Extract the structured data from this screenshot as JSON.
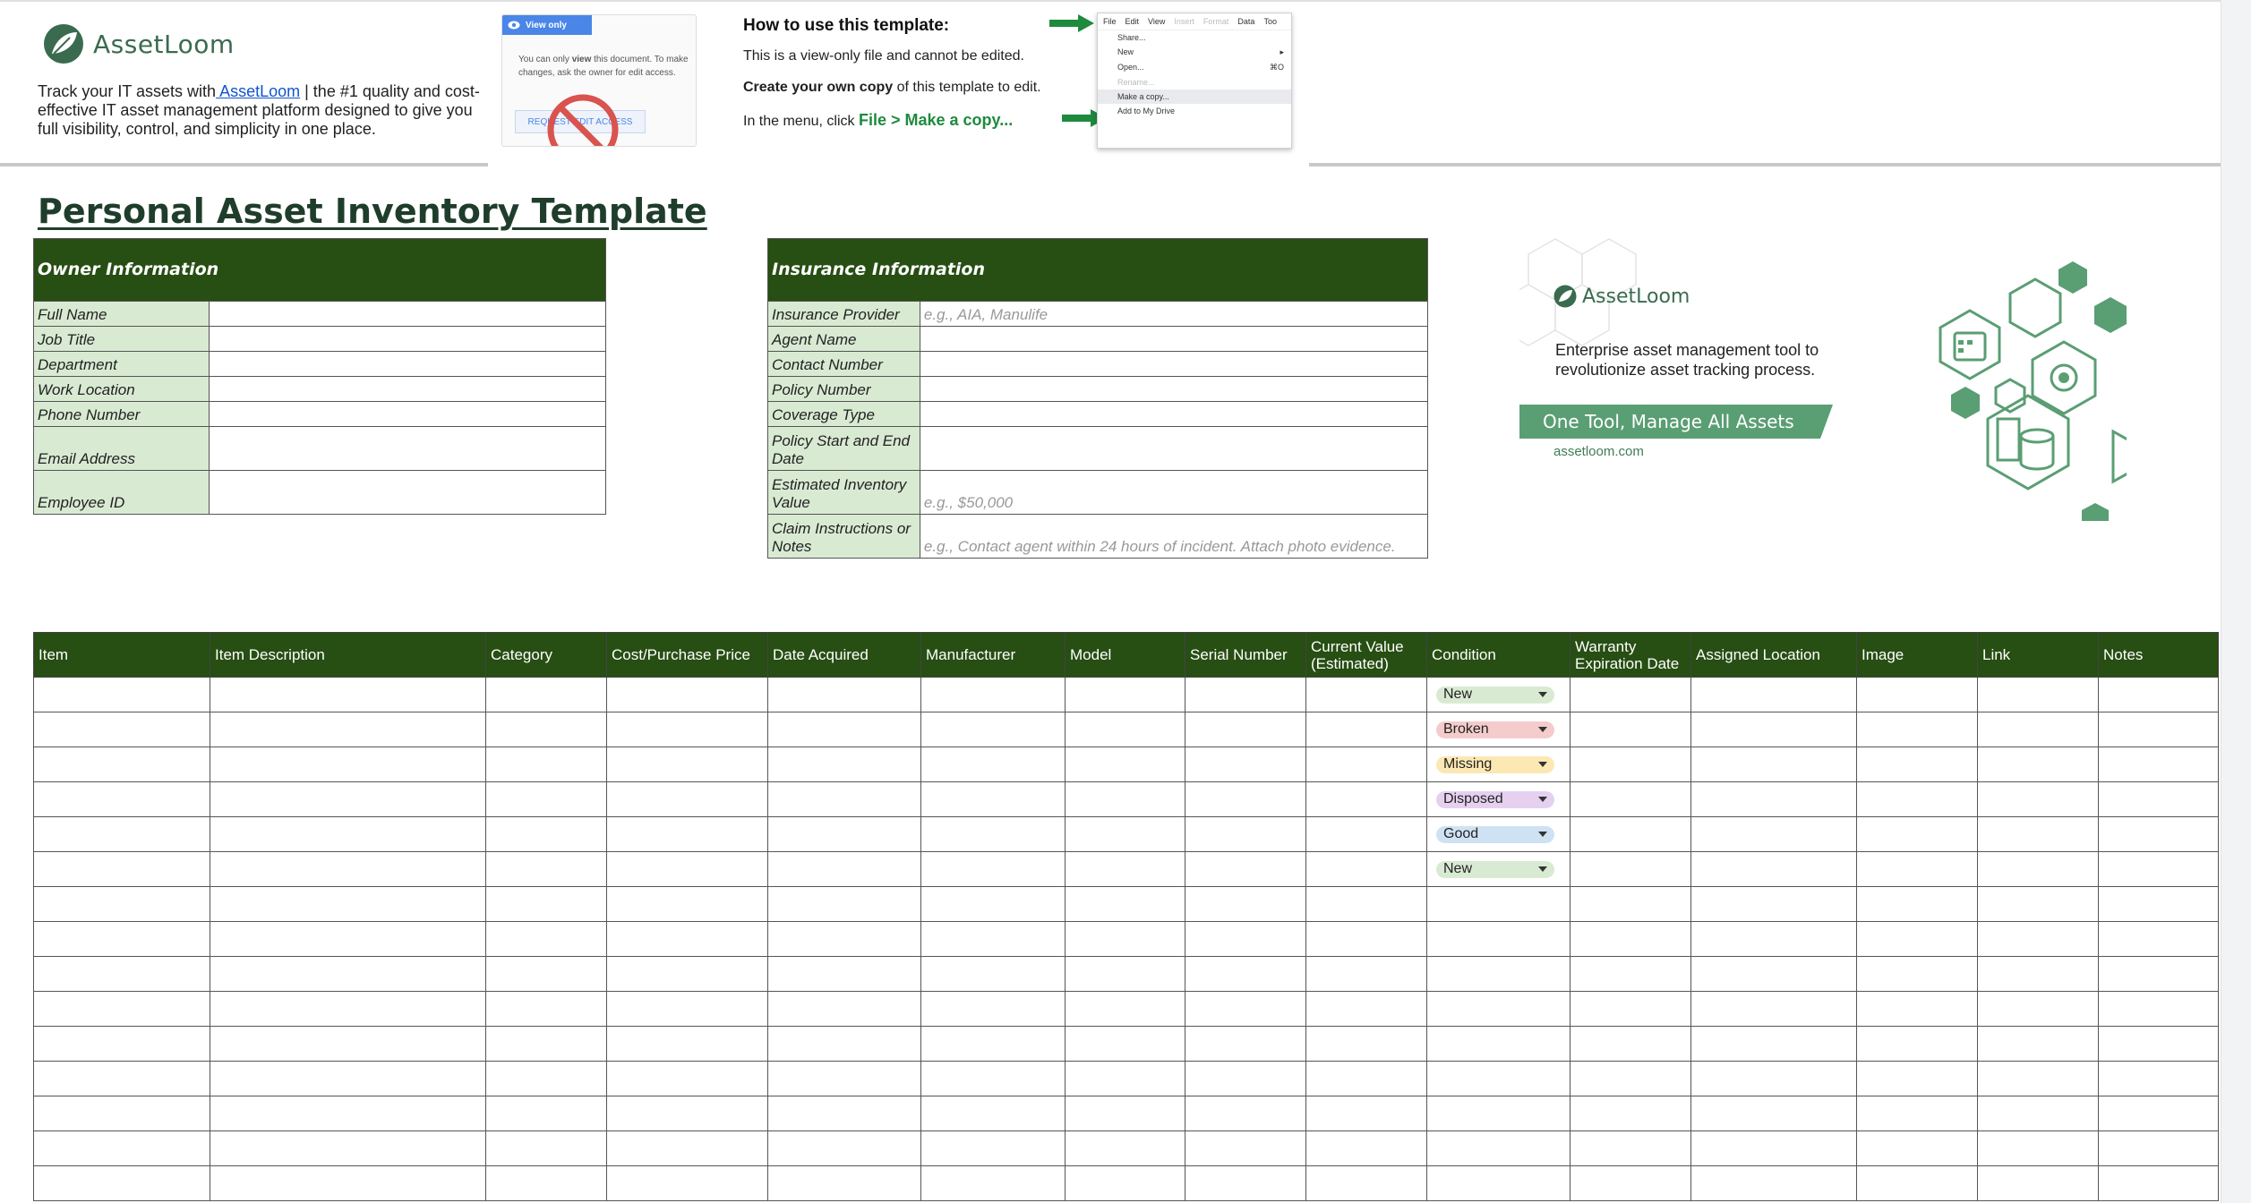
{
  "banner": {
    "brand": "AssetLoom",
    "intro_prefix": "Track your IT assets with",
    "intro_link": " AssetLoom",
    "intro_suffix": " | the #1 quality and cost-effective IT asset management platform designed to give you full visibility, control, and simplicity in one place.",
    "view_only": {
      "badge": "View only",
      "message_pre": "You can only ",
      "message_bold": "view",
      "message_post": " this document. To make changes, ask the owner for edit access.",
      "request_button": "REQUEST EDIT ACCESS"
    },
    "howto": {
      "title": "How to use this template:",
      "line1": "This is a view-only file and cannot be edited.",
      "line2_bold": "Create your own copy",
      "line2_rest": " of this template to edit.",
      "line3_pre": "In the menu, click ",
      "line3_green": "File > Make a copy..."
    },
    "menu_shot": {
      "top": [
        "File",
        "Edit",
        "View",
        "Insert",
        "Format",
        "Data",
        "Too"
      ],
      "top_faded": [
        false,
        false,
        false,
        true,
        true,
        false,
        false
      ],
      "items": [
        {
          "label": "Share...",
          "shortcut": "",
          "faded": false,
          "hl": false
        },
        {
          "label": "New",
          "shortcut": "▸",
          "faded": false,
          "hl": false
        },
        {
          "label": "Open...",
          "shortcut": "⌘O",
          "faded": false,
          "hl": false
        },
        {
          "label": "Rename...",
          "shortcut": "",
          "faded": true,
          "hl": false
        },
        {
          "label": "Make a copy...",
          "shortcut": "",
          "faded": false,
          "hl": true
        },
        {
          "label": "Add to My Drive",
          "shortcut": "",
          "faded": false,
          "hl": false
        }
      ]
    }
  },
  "page_title": "Personal Asset Inventory Template",
  "owner": {
    "header": "Owner Information",
    "rows": [
      {
        "label": "Full Name",
        "value": ""
      },
      {
        "label": "Job Title",
        "value": ""
      },
      {
        "label": "Department",
        "value": ""
      },
      {
        "label": "Work Location",
        "value": ""
      },
      {
        "label": "Phone Number",
        "value": ""
      },
      {
        "label": "Email Address",
        "value": "",
        "tall": true
      },
      {
        "label": "Employee ID",
        "value": "",
        "tall": true
      }
    ]
  },
  "insurance": {
    "header": "Insurance Information",
    "rows": [
      {
        "label": "Insurance Provider",
        "value": "e.g., AIA, Manulife"
      },
      {
        "label": "Agent Name",
        "value": ""
      },
      {
        "label": "Contact Number",
        "value": ""
      },
      {
        "label": "Policy Number",
        "value": ""
      },
      {
        "label": "Coverage Type",
        "value": ""
      },
      {
        "label": "Policy Start and End Date",
        "value": "",
        "tall": true
      },
      {
        "label": "Estimated Inventory Value",
        "value": "e.g., $50,000",
        "tall": true
      },
      {
        "label": "Claim Instructions or Notes",
        "value": "e.g., Contact agent within 24 hours of incident. Attach photo evidence.",
        "tall": true
      }
    ]
  },
  "ad": {
    "brand": "AssetLoom",
    "description": "Enterprise asset management tool to revolutionize asset tracking process.",
    "tagline": "One Tool, Manage All Assets",
    "url": "assetloom.com"
  },
  "inventory": {
    "columns": [
      "Item",
      "Item Description",
      "Category",
      "Cost/Purchase Price",
      "Date Acquired",
      "Manufacturer",
      "Model",
      "Serial Number",
      "Current Value (Estimated)",
      "Condition",
      "Warranty Expiration Date",
      "Assigned Location",
      "Image",
      "Link",
      "Notes"
    ],
    "conditions": [
      {
        "label": "New",
        "color": "#d9ead3"
      },
      {
        "label": "Broken",
        "color": "#f4cccc"
      },
      {
        "label": "Missing",
        "color": "#fce8b2"
      },
      {
        "label": "Disposed",
        "color": "#e6d0f0"
      },
      {
        "label": "Good",
        "color": "#cfe2f3"
      },
      {
        "label": "New",
        "color": "#d9ead3"
      }
    ],
    "row_count": 15
  },
  "colors": {
    "header_green": "#274e13",
    "label_green": "#d9ead3",
    "brand_green": "#3a6b4f"
  }
}
